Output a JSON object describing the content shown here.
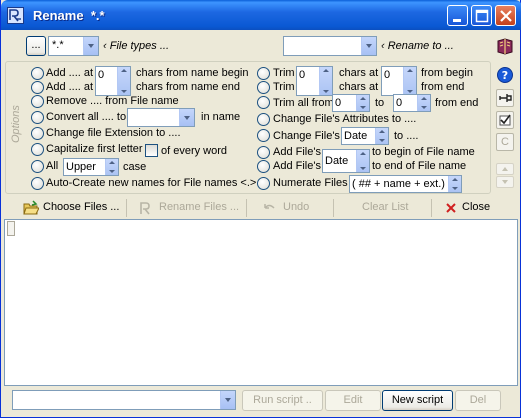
{
  "window": {
    "title": "Rename",
    "title_suffix": "*.*"
  },
  "toolbar": {
    "dots_label": "...",
    "filter_value": "*.*",
    "file_types_label": "‹ File types ...",
    "rename_to_value": "",
    "rename_to_label": "‹ Rename to ..."
  },
  "options": {
    "group_label": "Options",
    "left": {
      "add1": {
        "a": "Add .... at",
        "value": "0",
        "b": "chars from name begin"
      },
      "add2": {
        "a": "Add .... at",
        "b": "chars from name end"
      },
      "remove": "Remove .... from File name",
      "convert": {
        "a": "Convert all .... to",
        "value": "",
        "b": "in name"
      },
      "change_ext": "Change file Extension to ....",
      "capitalize": {
        "a": "Capitalize first letter",
        "b": "of every word"
      },
      "all_case": {
        "a": "All",
        "value": "Upper",
        "b": "case"
      },
      "auto_create": "Auto-Create new names for File names <.>"
    },
    "right": {
      "trim1": {
        "a": "Trim",
        "value1": "0",
        "b": "chars at",
        "value2": "0",
        "c": "from begin"
      },
      "trim2": {
        "a": "Trim",
        "b": "chars at",
        "c": "from  end"
      },
      "trim_all": {
        "a": "Trim all from",
        "value1": "0",
        "b": "to",
        "value2": "0",
        "c": "from end"
      },
      "change_attrs": "Change File's Attributes to ....",
      "change_date": {
        "a": "Change File's",
        "value": "Date",
        "b": "to ...."
      },
      "add_begin": {
        "a": "Add File's",
        "b": "to begin of File name"
      },
      "add_end": {
        "a": "Add File's",
        "value": "Date",
        "b": "to end of File name"
      },
      "numerate": {
        "a": "Numerate Files",
        "value": "( ## + name + ext.)"
      }
    }
  },
  "side_tools": {
    "help_label": "?",
    "clear_label": "C"
  },
  "actions": {
    "choose_files": "Choose Files ...",
    "rename_files": "Rename Files ...",
    "undo": "Undo",
    "clear_list": "Clear List",
    "close": "Close"
  },
  "script_bar": {
    "script_value": "",
    "run_script": "Run script ..",
    "edit": "Edit",
    "new_script": "New script",
    "del": "Del"
  },
  "colors": {
    "titlebar": "#0a58d3",
    "window_bg": "#ece9d8",
    "disabled_text": "#aca899"
  }
}
